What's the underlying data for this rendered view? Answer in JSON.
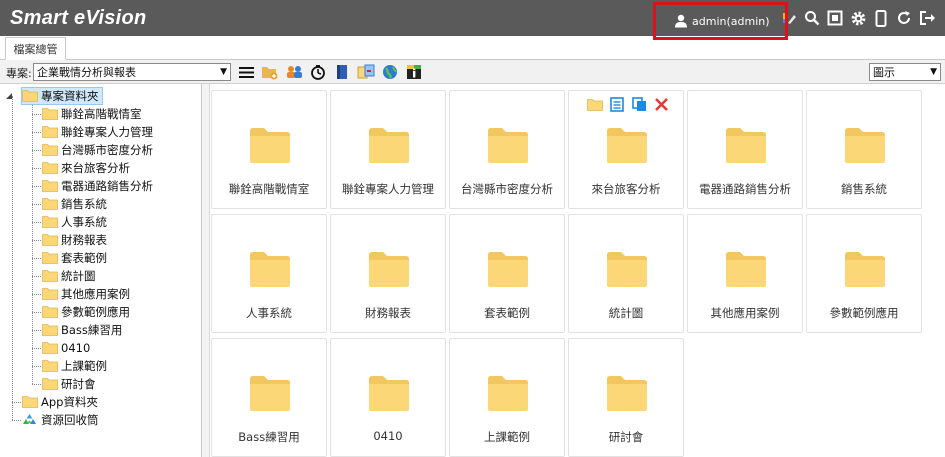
{
  "header": {
    "brand": "Smart eVision",
    "user_label": "admin(admin)",
    "icons": [
      "user-icon",
      "palette-icon",
      "search-icon",
      "fullscreen-icon",
      "gear-icon",
      "mobile-icon",
      "refresh-icon",
      "logout-icon"
    ]
  },
  "tabs": [
    {
      "label": "檔案總管"
    }
  ],
  "toolbar": {
    "project_label": "專案:",
    "project_value": "企業戰情分析與報表",
    "view_value": "圖示",
    "icons": [
      "list-icon",
      "new-folder-icon",
      "permission-icon",
      "timer-icon",
      "book-icon",
      "import-icon",
      "globe-icon",
      "info-icon"
    ]
  },
  "tree": {
    "root": "專案資料夾",
    "children": [
      "聯銓高階戰情室",
      "聯銓專案人力管理",
      "台灣縣市密度分析",
      "來台旅客分析",
      "電器通路銷售分析",
      "銷售系統",
      "人事系統",
      "財務報表",
      "套表範例",
      "統計圖",
      "其他應用案例",
      "參數範例應用",
      "Bass練習用",
      "0410",
      "上課範例",
      "研討會"
    ],
    "app_folder": "App資料夾",
    "recycle": "資源回收筒"
  },
  "grid": {
    "folders": [
      "聯銓高階戰情室",
      "聯銓專案人力管理",
      "台灣縣市密度分析",
      "來台旅客分析",
      "電器通路銷售分析",
      "銷售系統",
      "人事系統",
      "財務報表",
      "套表範例",
      "統計圖",
      "其他應用案例",
      "參數範例應用",
      "Bass練習用",
      "0410",
      "上課範例",
      "研討會"
    ],
    "hover_actions": [
      "open-folder-icon",
      "properties-icon",
      "copy-icon",
      "delete-icon"
    ]
  },
  "colors": {
    "header_bg": "#5a5a5a",
    "folder": "#fbd778",
    "folder_tab": "#f3c75f",
    "selected": "#cfe8fb",
    "highlight_border": "#e0101a",
    "delete": "#e53935",
    "action_blue": "#1e88e5"
  }
}
